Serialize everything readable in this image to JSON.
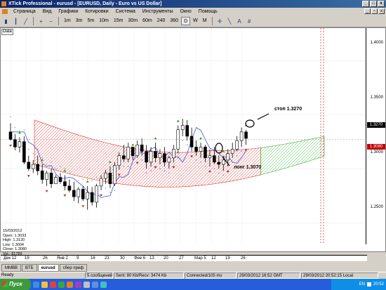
{
  "window": {
    "title": "XTick Professional - eurusd - [EURUSD, Daily - Euro vs US Dollar]",
    "min": "_",
    "max": "□",
    "close": "x"
  },
  "menu": [
    "Страница",
    "Вид",
    "Графики",
    "Котировки",
    "Система",
    "Инструменты",
    "Окно",
    "Помощь"
  ],
  "toolbar": {
    "timeframes": [
      "1m",
      "3m",
      "5m",
      "10m",
      "15m",
      "30m",
      "60m",
      "240",
      "360",
      "D",
      "W",
      "M"
    ],
    "active": "D"
  },
  "chart": {
    "data_label": "Data",
    "price_ticks": [
      "1.4000",
      "1.3500",
      "1.3000",
      "1.2500"
    ],
    "current_price": "1.3270",
    "current_price2": "1.3080",
    "dates": [
      "Дек 12",
      "19",
      "26",
      "Янв 2",
      "9",
      "16",
      "23",
      "30",
      "Фев 6",
      "13",
      "20",
      "27",
      "Мар 5",
      "12",
      "19",
      "26"
    ],
    "ohlc": {
      "date": "15/03/2012",
      "open": "Open: 1.3033",
      "high": "High: 1.3120",
      "low": "Low: 1.3004",
      "close": "Close: 1.3080",
      "vol": "Vol.: 81789"
    },
    "annotations": {
      "stop": "стоп 1.3270",
      "long": "лонг 1.3070"
    }
  },
  "chart_data": {
    "type": "candlestick",
    "symbol": "EURUSD",
    "timeframe": "Daily",
    "ylim": [
      1.23,
      1.43
    ],
    "candles": [
      [
        1.334,
        1.342,
        1.326,
        1.327
      ],
      [
        1.327,
        1.332,
        1.317,
        1.32
      ],
      [
        1.32,
        1.329,
        1.315,
        1.325
      ],
      [
        1.325,
        1.33,
        1.304,
        1.306
      ],
      [
        1.306,
        1.312,
        1.298,
        1.3
      ],
      [
        1.3,
        1.308,
        1.296,
        1.304
      ],
      [
        1.304,
        1.312,
        1.294,
        1.298
      ],
      [
        1.298,
        1.304,
        1.286,
        1.29
      ],
      [
        1.29,
        1.298,
        1.284,
        1.296
      ],
      [
        1.296,
        1.3,
        1.282,
        1.286
      ],
      [
        1.286,
        1.294,
        1.29,
        1.292
      ],
      [
        1.292,
        1.296,
        1.286,
        1.288
      ],
      [
        1.288,
        1.294,
        1.28,
        1.284
      ],
      [
        1.284,
        1.29,
        1.278,
        1.28
      ],
      [
        1.28,
        1.288,
        1.27,
        1.274
      ],
      [
        1.274,
        1.283,
        1.268,
        1.281
      ],
      [
        1.281,
        1.284,
        1.27,
        1.272
      ],
      [
        1.272,
        1.284,
        1.262,
        1.278
      ],
      [
        1.278,
        1.283,
        1.266,
        1.269
      ],
      [
        1.269,
        1.286,
        1.264,
        1.284
      ],
      [
        1.284,
        1.294,
        1.28,
        1.291
      ],
      [
        1.291,
        1.299,
        1.286,
        1.296
      ],
      [
        1.296,
        1.302,
        1.282,
        1.286
      ],
      [
        1.286,
        1.306,
        1.284,
        1.303
      ],
      [
        1.303,
        1.315,
        1.299,
        1.312
      ],
      [
        1.312,
        1.322,
        1.306,
        1.309
      ],
      [
        1.309,
        1.324,
        1.306,
        1.32
      ],
      [
        1.32,
        1.318,
        1.308,
        1.312
      ],
      [
        1.312,
        1.326,
        1.31,
        1.322
      ],
      [
        1.322,
        1.328,
        1.312,
        1.316
      ],
      [
        1.316,
        1.322,
        1.3,
        1.306
      ],
      [
        1.306,
        1.32,
        1.302,
        1.316
      ],
      [
        1.316,
        1.324,
        1.306,
        1.31
      ],
      [
        1.31,
        1.318,
        1.304,
        1.314
      ],
      [
        1.314,
        1.32,
        1.302,
        1.306
      ],
      [
        1.306,
        1.312,
        1.3,
        1.31
      ],
      [
        1.31,
        1.322,
        1.306,
        1.318
      ],
      [
        1.318,
        1.34,
        1.314,
        1.336
      ],
      [
        1.336,
        1.346,
        1.33,
        1.34
      ],
      [
        1.34,
        1.345,
        1.326,
        1.33
      ],
      [
        1.33,
        1.338,
        1.316,
        1.32
      ],
      [
        1.32,
        1.326,
        1.312,
        1.316
      ],
      [
        1.316,
        1.324,
        1.31,
        1.32
      ],
      [
        1.32,
        1.322,
        1.306,
        1.31
      ],
      [
        1.31,
        1.318,
        1.302,
        1.312
      ],
      [
        1.312,
        1.32,
        1.304,
        1.306
      ],
      [
        1.306,
        1.312,
        1.3,
        1.304
      ],
      [
        1.304,
        1.312,
        1.298,
        1.308
      ],
      [
        1.308,
        1.318,
        1.302,
        1.314
      ],
      [
        1.314,
        1.324,
        1.31,
        1.318
      ],
      [
        1.318,
        1.33,
        1.316,
        1.326
      ],
      [
        1.326,
        1.338,
        1.32,
        1.334
      ],
      [
        1.334,
        1.336,
        1.322,
        1.328
      ]
    ]
  },
  "tabs": [
    "MMBB",
    "BTБ",
    "eurusd",
    "сбер преф"
  ],
  "tabs_active": "eurusd",
  "status": {
    "ready": "Ready",
    "messages": "5 сообщений",
    "sent": "Sent: 80 Kb/Recv: 3474 Kb",
    "connected": "Connected/105 ms",
    "gmt": "29/03/2012 16:52 GMT",
    "local": "29/03/2012 20:52:15 Local"
  },
  "taskbar": {
    "start": "Пуск",
    "lang": "EN",
    "time": "20:52"
  }
}
